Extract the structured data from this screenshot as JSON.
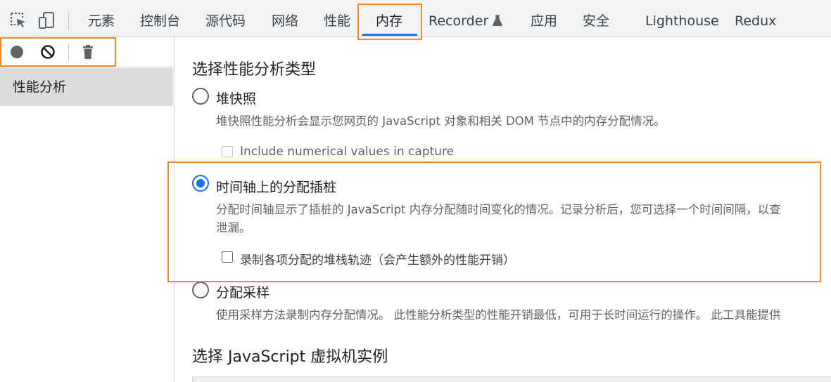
{
  "tabs": [
    {
      "label": "元素"
    },
    {
      "label": "控制台"
    },
    {
      "label": "源代码"
    },
    {
      "label": "网络"
    },
    {
      "label": "性能"
    },
    {
      "label": "内存",
      "active": true
    },
    {
      "label": "Recorder"
    },
    {
      "label": "应用"
    },
    {
      "label": "安全"
    },
    {
      "label": "Lighthouse"
    },
    {
      "label": "Redux"
    }
  ],
  "sidebar": {
    "items": [
      {
        "label": "性能分析"
      }
    ]
  },
  "main": {
    "section_title": "选择性能分析类型",
    "options": [
      {
        "label": "堆快照",
        "selected": false,
        "description": "堆快照性能分析会显示您网页的 JavaScript 对象和相关 DOM 节点中的内存分配情况。",
        "checkbox_label": "Include numerical values in capture",
        "checkbox_enabled": false
      },
      {
        "label": "时间轴上的分配插桩",
        "selected": true,
        "description_line1": "分配时间轴显示了插桩的 JavaScript 内存分配随时间变化的情况。记录分析后，您可选择一个时间间隔，以查",
        "description_line2": "泄漏。",
        "checkbox_label": "录制各项分配的堆栈轨迹（会产生额外的性能开销）",
        "checkbox_enabled": true
      },
      {
        "label": "分配采样",
        "selected": false,
        "description": "使用采样方法录制内存分配情况。 此性能分析类型的性能开销最低，可用于长时间运行的操作。 此工具能提供"
      }
    ],
    "vm_title": "选择 JavaScript 虚拟机实例"
  },
  "colors": {
    "accent": "#1a73e8",
    "highlight": "#f08a2a"
  }
}
